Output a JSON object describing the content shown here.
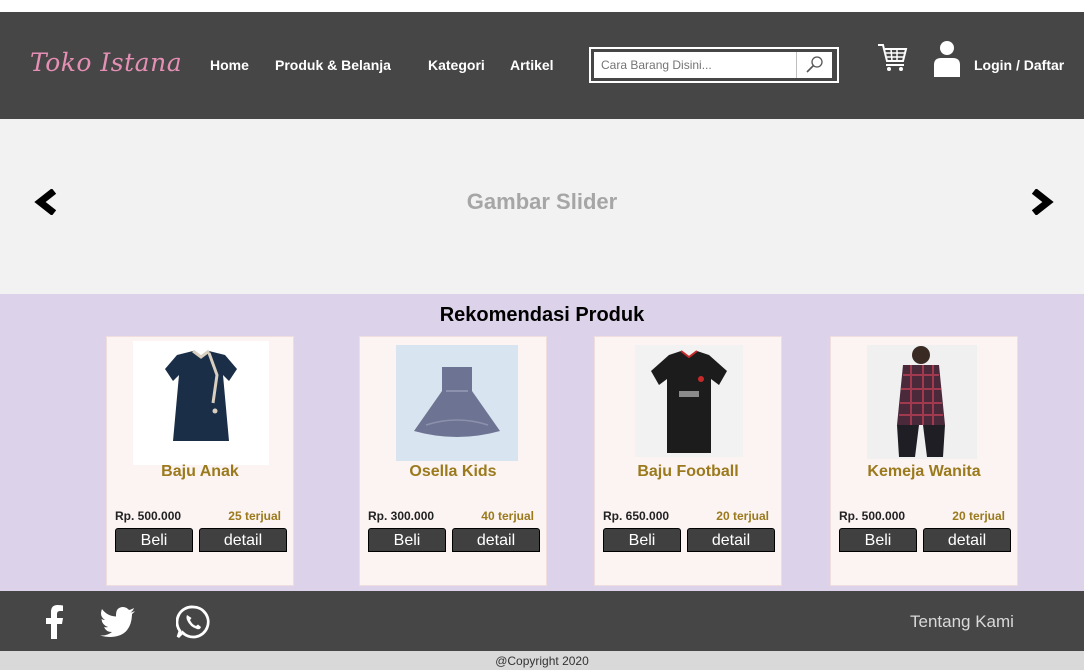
{
  "header": {
    "brand": "Toko Istana",
    "nav": [
      {
        "label": "Home"
      },
      {
        "label": "Produk & Belanja"
      },
      {
        "label": "Kategori"
      },
      {
        "label": "Artikel"
      }
    ],
    "search": {
      "placeholder": "Cara Barang Disini..."
    },
    "login_label": "Login / Daftar"
  },
  "slider": {
    "text": "Gambar Slider"
  },
  "recommendations": {
    "title": "Rekomendasi Produk",
    "products": [
      {
        "name": "Baju Anak",
        "price": "Rp. 500.000",
        "sold": "25 terjual",
        "buy_label": "Beli",
        "detail_label": "detail"
      },
      {
        "name": "Osella Kids",
        "price": "Rp. 300.000",
        "sold": "40 terjual",
        "buy_label": "Beli",
        "detail_label": "detail"
      },
      {
        "name": "Baju Football",
        "price": "Rp. 650.000",
        "sold": "20 terjual",
        "buy_label": "Beli",
        "detail_label": "detail"
      },
      {
        "name": "Kemeja Wanita",
        "price": "Rp. 500.000",
        "sold": "20 terjual",
        "buy_label": "Beli",
        "detail_label": "detail"
      }
    ]
  },
  "footer": {
    "social_icons": [
      "facebook-icon",
      "twitter-icon",
      "whatsapp-icon"
    ],
    "about_label": "Tentang Kami",
    "copyright": "@Copyright 2020"
  },
  "colors": {
    "nav_bg": "#464646",
    "brand": "#e58fb4",
    "slider_bg": "#f2f2f2",
    "reco_bg": "#dcd2ea",
    "card_bg": "#fcf3f3",
    "product_name": "#9a7a1c",
    "button_bg": "#404040"
  }
}
